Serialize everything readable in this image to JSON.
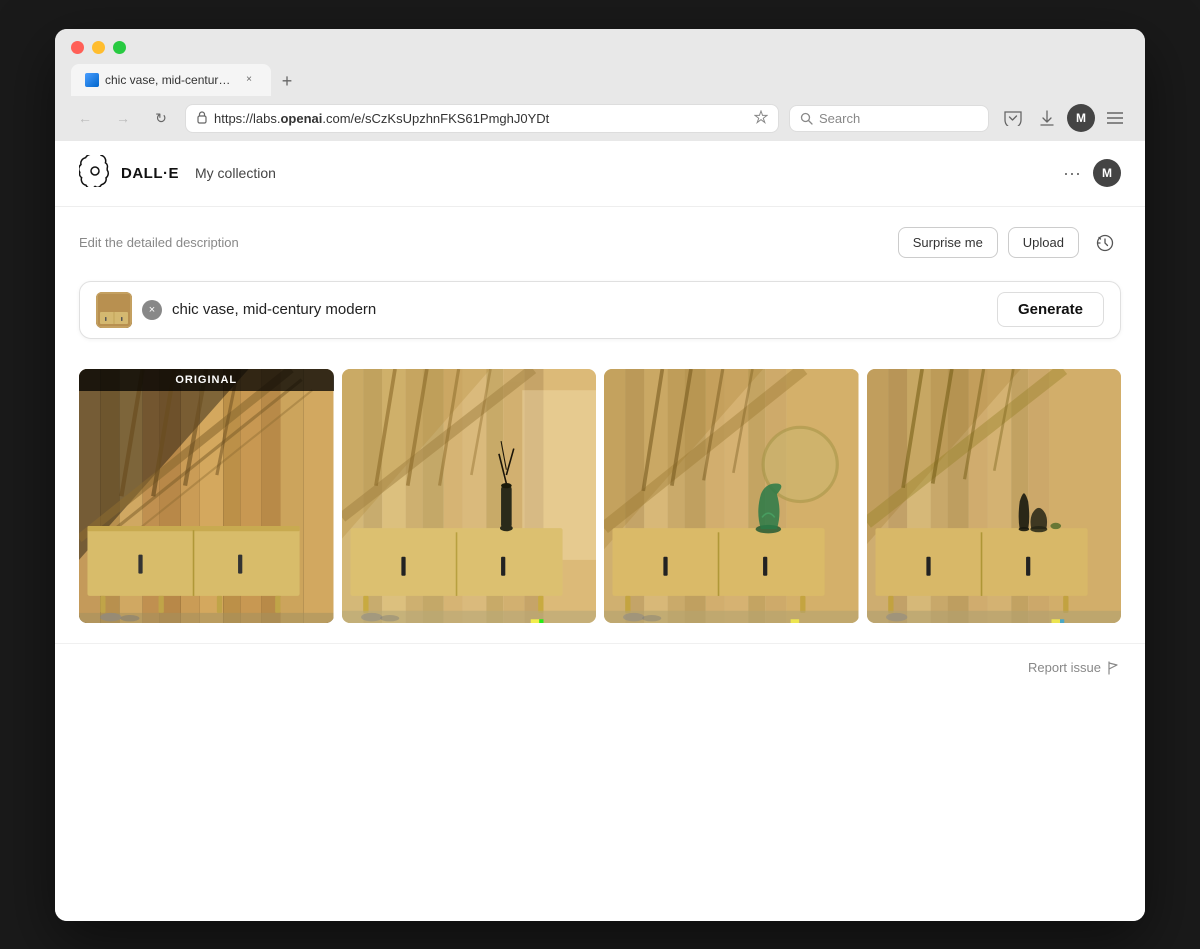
{
  "browser": {
    "tab": {
      "favicon_alt": "DALL-E tab favicon",
      "label": "chic vase, mid-century modern",
      "close_label": "×"
    },
    "new_tab_label": "+",
    "nav": {
      "back_label": "←",
      "forward_label": "→",
      "refresh_label": "↻",
      "address": {
        "lock_icon": "🔒",
        "url_prefix": "https://labs.",
        "url_domain": "openai",
        "url_suffix": ".com/e/sCzKsUpzhnFKS61PmghJ0YDt"
      },
      "star_icon": "☆",
      "search_placeholder": "Search"
    },
    "toolbar": {
      "pocket_icon": "pocket",
      "download_icon": "download",
      "user_initial": "M",
      "menu_icon": "☰"
    }
  },
  "app": {
    "logo_alt": "OpenAI logo",
    "name": "DALL·E",
    "my_collection_label": "My collection",
    "more_label": "···",
    "user_initial": "M"
  },
  "editor": {
    "description_placeholder": "Edit the detailed description",
    "surprise_label": "Surprise me",
    "upload_label": "Upload",
    "history_icon": "history",
    "prompt": {
      "thumbnail_alt": "reference image thumbnail",
      "clear_label": "×",
      "text": "chic vase, mid-century modern",
      "generate_label": "Generate"
    }
  },
  "images": [
    {
      "id": 1,
      "badge": "ORIGINAL",
      "alt": "Original image - wooden sideboard against wood wall"
    },
    {
      "id": 2,
      "badge": null,
      "alt": "Generated variation 1 - sideboard with tall vase"
    },
    {
      "id": 3,
      "badge": null,
      "alt": "Generated variation 2 - sideboard with green glass vase"
    },
    {
      "id": 4,
      "badge": null,
      "alt": "Generated variation 3 - sideboard with two vases"
    }
  ],
  "footer": {
    "report_label": "Report issue",
    "report_icon": "flag"
  }
}
